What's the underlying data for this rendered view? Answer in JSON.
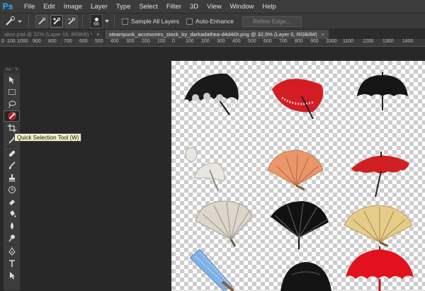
{
  "app": {
    "logo": "Ps"
  },
  "menu": [
    "File",
    "Edit",
    "Image",
    "Layer",
    "Type",
    "Select",
    "Filter",
    "3D",
    "View",
    "Window",
    "Help"
  ],
  "options": {
    "brush_size": "66",
    "sample_all_layers": "Sample All Layers",
    "auto_enhance": "Auto-Enhance",
    "refine_edge": "Refine Edge..."
  },
  "tabs": [
    {
      "label": "alice.psd @ 22% (Layer 16, RGB/8) *",
      "close": "×"
    },
    {
      "label": "steampunk_accesories_stock_by_darkadathea-d4d4i0r.png @ 32,5% (Layer 0, RGB/8#)",
      "close": "×"
    }
  ],
  "ruler": [
    "0",
    "100",
    "1000",
    "900",
    "800",
    "700",
    "600",
    "500",
    "400",
    "300",
    "200",
    "100",
    "0",
    "100",
    "200",
    "300",
    "400",
    "500",
    "600",
    "700",
    "800",
    "900",
    "1000",
    "1100",
    "1200",
    "1300",
    "1400"
  ],
  "toolbar": {
    "collapse": "<<",
    "close": "×"
  },
  "tooltip": "Quick Selection Tool (W)",
  "canvas": {
    "items": [
      {
        "name": "black-lace-umbrella",
        "color": "#1a1a1a"
      },
      {
        "name": "red-lace-umbrella",
        "color": "#d41c24"
      },
      {
        "name": "black-umbrella",
        "color": "#151515"
      },
      {
        "name": "white-parasol",
        "color": "#e8e6e0"
      },
      {
        "name": "orange-fan",
        "color": "#e9966a"
      },
      {
        "name": "red-parasol",
        "color": "#cf1f23"
      },
      {
        "name": "white-lace-fan",
        "color": "#dcd6cc"
      },
      {
        "name": "black-lace-fan",
        "color": "#111111"
      },
      {
        "name": "cream-fan",
        "color": "#e6cc8a"
      },
      {
        "name": "blue-fan",
        "color": "#7fb0e6"
      },
      {
        "name": "black-bonnet",
        "color": "#141414"
      },
      {
        "name": "red-ruffled-parasol",
        "color": "#e1121d"
      }
    ]
  }
}
